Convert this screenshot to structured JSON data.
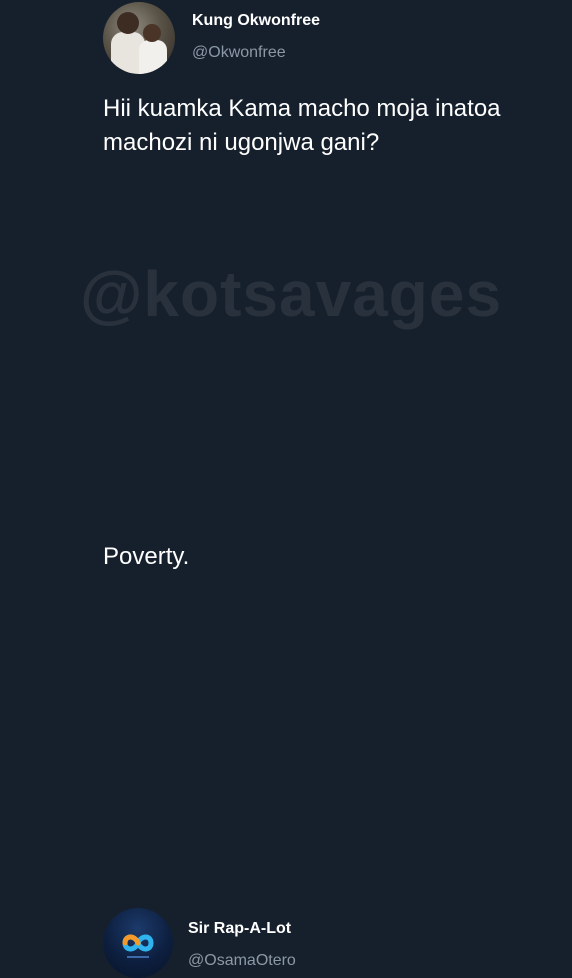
{
  "colors": {
    "background": "#16202c",
    "text": "#ffffff",
    "secondary_text": "#8b98a5"
  },
  "tweet": {
    "display_name": "Kung Okwonfree",
    "handle": "@Okwonfree",
    "text": "Hii kuamka Kama macho moja inatoa\nmachozi ni ugonjwa gani?",
    "avatar_icon": "user-photo-avatar"
  },
  "watermark": "@kotsavages",
  "reply": {
    "display_name": "Sir Rap-A-Lot",
    "handle": "@OsamaOtero",
    "text": "Poverty.",
    "avatar_icon": "infinity-logo-avatar"
  }
}
